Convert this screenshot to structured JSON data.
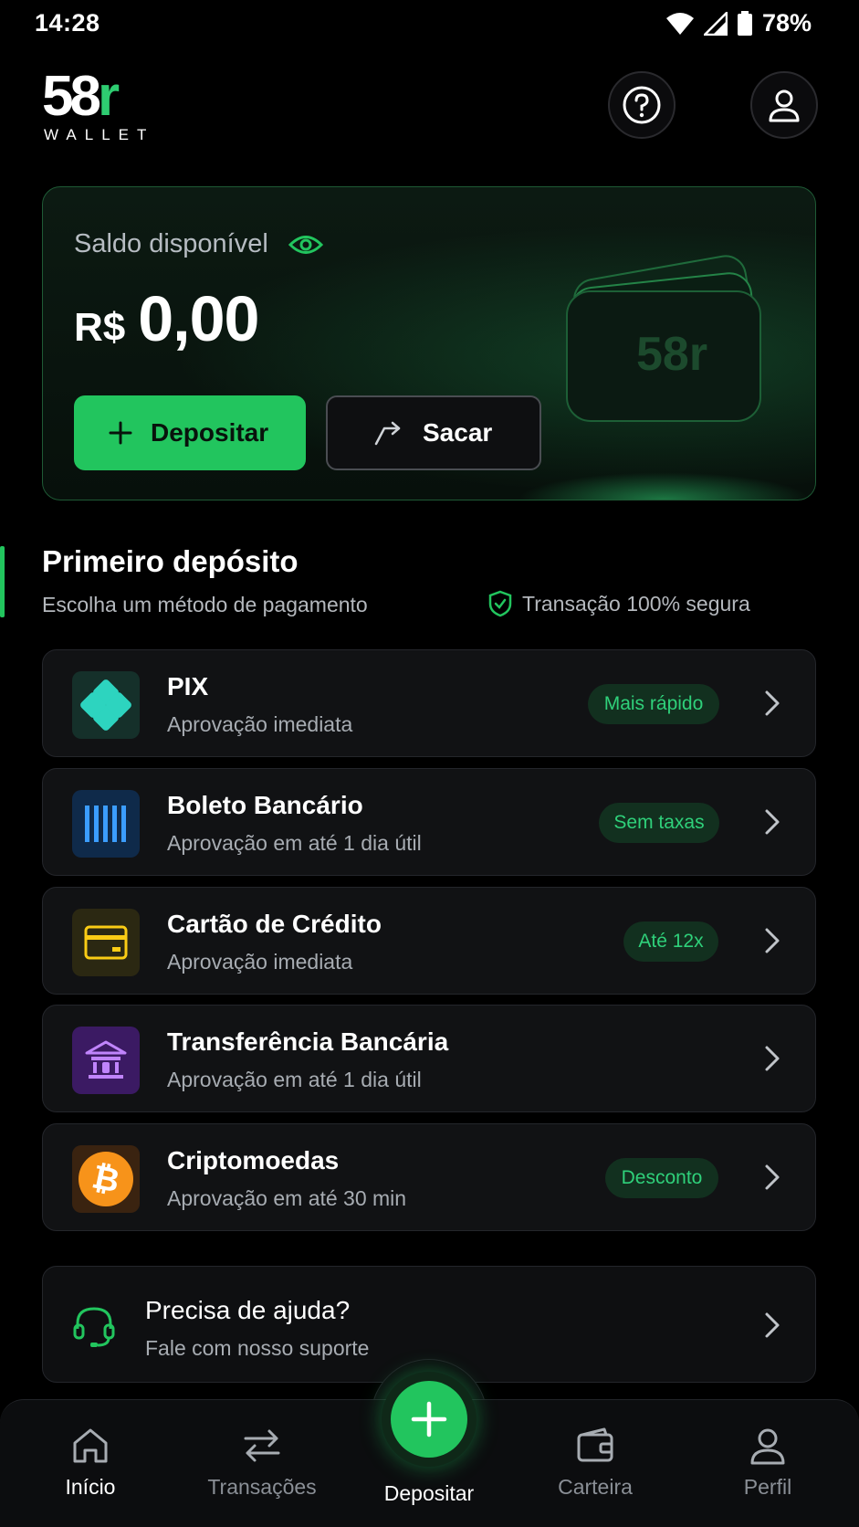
{
  "status_bar": {
    "time": "14:28",
    "battery": "78%"
  },
  "brand": {
    "logo_main": "58",
    "logo_accent": "r",
    "logo_sub": "WALLET",
    "accent_color": "#22c55e"
  },
  "balance": {
    "label": "Saldo disponível",
    "currency": "R$",
    "amount": "0,00",
    "deposit_label": "Depositar",
    "withdraw_label": "Sacar",
    "art_text": "58r"
  },
  "section": {
    "title": "Primeiro depósito",
    "subtitle": "Escolha um método de pagamento",
    "secure_text": "Transação 100% segura"
  },
  "methods": [
    {
      "name": "PIX",
      "desc": "Aprovação imediata",
      "badge": "Mais rápido",
      "icon": "pix-icon"
    },
    {
      "name": "Boleto Bancário",
      "desc": "Aprovação em até 1 dia útil",
      "badge": "Sem taxas",
      "icon": "barcode-icon"
    },
    {
      "name": "Cartão de Crédito",
      "desc": "Aprovação imediata",
      "badge": "Até 12x",
      "icon": "credit-card-icon"
    },
    {
      "name": "Transferência Bancária",
      "desc": "Aprovação em até 1 dia útil",
      "badge": "",
      "icon": "bank-icon"
    },
    {
      "name": "Criptomoedas",
      "desc": "Aprovação em até 30 min",
      "badge": "Desconto",
      "icon": "bitcoin-icon"
    }
  ],
  "help": {
    "title": "Precisa de ajuda?",
    "subtitle": "Fale com nosso suporte"
  },
  "nav": {
    "home": "Início",
    "transactions": "Transações",
    "deposit": "Depositar",
    "wallet": "Carteira",
    "profile": "Perfil"
  }
}
